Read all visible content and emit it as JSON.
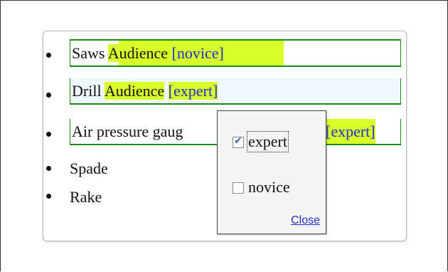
{
  "items": [
    {
      "name": "Saws",
      "audience_label": "Audience",
      "level": "[novice]"
    },
    {
      "name": "Drill",
      "audience_label": "Audience",
      "level": "[expert]"
    },
    {
      "name": "Air pressure gaug",
      "level": "[expert]"
    },
    {
      "name": "Spade"
    },
    {
      "name": "Rake"
    }
  ],
  "popup": {
    "options": [
      {
        "label": "expert",
        "checked": true
      },
      {
        "label": "novice",
        "checked": false
      }
    ],
    "close_label": "Close"
  },
  "colors": {
    "highlight": "#d9ff2a",
    "row_border": "#1a8c1a",
    "link": "#1f2fd0",
    "hover_bg": "#f0f8ff"
  }
}
